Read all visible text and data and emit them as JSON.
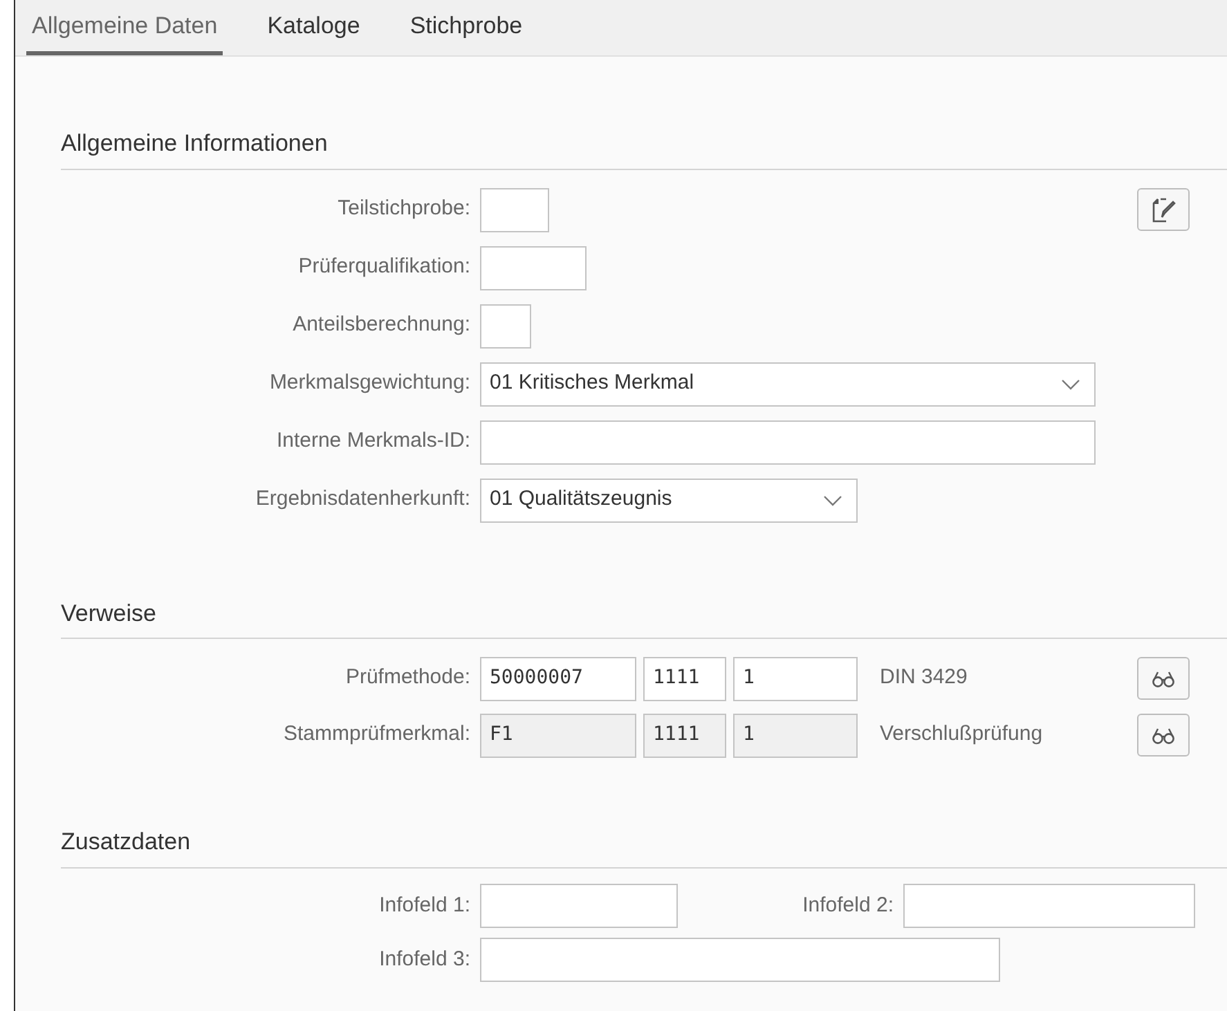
{
  "tabs": [
    {
      "label": "Allgemeine Daten",
      "selected": true
    },
    {
      "label": "Kataloge",
      "selected": false
    },
    {
      "label": "Stichprobe",
      "selected": false
    }
  ],
  "sections": [
    {
      "title": "Allgemeine Informationen",
      "rows": [
        {
          "cells": [
            {
              "kind": "label",
              "text": "Teilstichprobe:"
            },
            {
              "kind": "input"
            },
            {
              "kind": "edit-button"
            }
          ]
        },
        {
          "cells": [
            {
              "kind": "label",
              "text": "Prüferqualifikation:"
            },
            {
              "kind": "input"
            }
          ]
        },
        {
          "cells": [
            {
              "kind": "label",
              "text": "Anteilsberechnung:"
            },
            {
              "kind": "input"
            }
          ]
        },
        {
          "cells": [
            {
              "kind": "label",
              "text": "Merkmalsgewichtung:"
            },
            {
              "kind": "dropdown",
              "value": "01 Kritisches Merkmal"
            }
          ]
        },
        {
          "cells": [
            {
              "kind": "label",
              "text": "Interne Merkmals-ID:"
            },
            {
              "kind": "input"
            }
          ]
        },
        {
          "cells": [
            {
              "kind": "label",
              "text": "Ergebnisdatenherkunft:"
            },
            {
              "kind": "dropdown",
              "value": "01 Qualitätszeugnis"
            }
          ]
        }
      ]
    },
    {
      "title": "Verweise",
      "rows": [
        {
          "cells": [
            {
              "kind": "label",
              "text": "Prüfmethode:"
            },
            {
              "kind": "input",
              "value": "50000007",
              "disabled": false
            },
            {
              "kind": "input",
              "value": "1111",
              "disabled": false
            },
            {
              "kind": "input",
              "value": "1",
              "disabled": false
            },
            {
              "kind": "text",
              "text": "DIN 3429"
            },
            {
              "kind": "view-button"
            }
          ]
        },
        {
          "cells": [
            {
              "kind": "label",
              "text": "Stammprüfmerkmal:"
            },
            {
              "kind": "input",
              "value": "F1",
              "disabled": true
            },
            {
              "kind": "input",
              "value": "1111",
              "disabled": true
            },
            {
              "kind": "input",
              "value": "1",
              "disabled": true
            },
            {
              "kind": "text",
              "text": "Verschlußprüfung"
            },
            {
              "kind": "view-button"
            }
          ]
        }
      ]
    },
    {
      "title": "Zusatzdaten",
      "rows": [
        {
          "cells": [
            {
              "kind": "label",
              "text": "Infofeld 1:"
            },
            {
              "kind": "input"
            },
            {
              "kind": "label",
              "text": "Infofeld 2:"
            },
            {
              "kind": "input"
            }
          ]
        },
        {
          "cells": [
            {
              "kind": "label",
              "text": "Infofeld 3:"
            },
            {
              "kind": "input"
            }
          ]
        }
      ]
    }
  ]
}
